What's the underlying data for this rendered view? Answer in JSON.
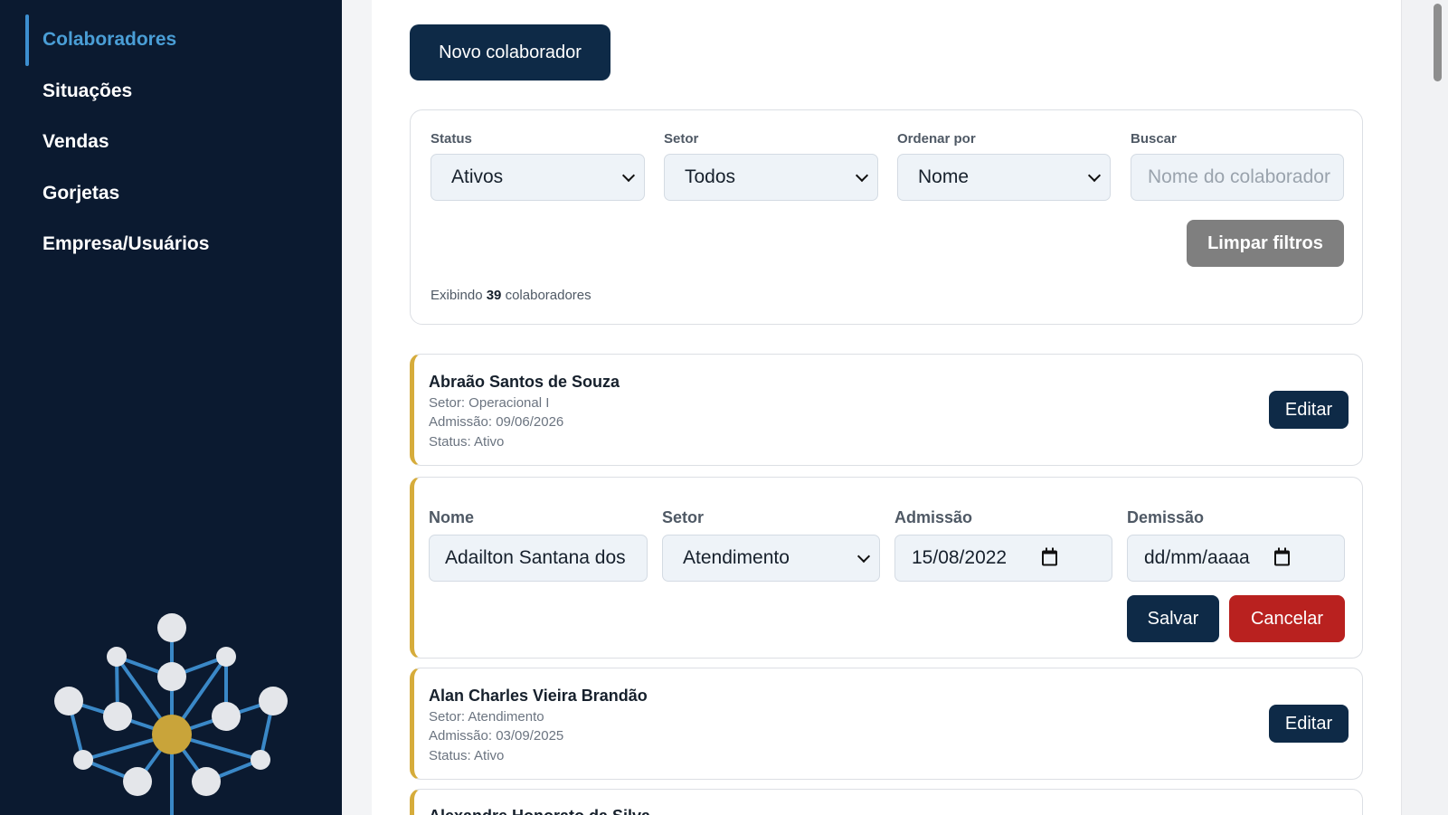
{
  "sidebar": {
    "items": [
      {
        "label": "Colaboradores",
        "active": true
      },
      {
        "label": "Situações",
        "active": false
      },
      {
        "label": "Vendas",
        "active": false
      },
      {
        "label": "Gorjetas",
        "active": false
      },
      {
        "label": "Empresa/Usuários",
        "active": false
      }
    ]
  },
  "toolbar": {
    "new_label": "Novo colaborador"
  },
  "filters": {
    "status": {
      "label": "Status",
      "value": "Ativos"
    },
    "sector": {
      "label": "Setor",
      "value": "Todos"
    },
    "order": {
      "label": "Ordenar por",
      "value": "Nome"
    },
    "search": {
      "label": "Buscar",
      "placeholder": "Nome do colaborador"
    },
    "clear_label": "Limpar filtros",
    "count_prefix": "Exibindo",
    "count_value": "39",
    "count_suffix": "colaboradores"
  },
  "employees": [
    {
      "name": "Abraão Santos de Souza",
      "sector": "Setor: Operacional I",
      "admission": "Admissão: 09/06/2026",
      "status": "Status: Ativo",
      "edit_label": "Editar"
    },
    {
      "name": "Alan Charles Vieira Brandão",
      "sector": "Setor: Atendimento",
      "admission": "Admissão: 03/09/2025",
      "status": "Status: Ativo",
      "edit_label": "Editar"
    },
    {
      "name": "Alexandre Honorato da Silva"
    }
  ],
  "edit_form": {
    "name_label": "Nome",
    "name_value": "Adailton Santana dos",
    "sector_label": "Setor",
    "sector_value": "Atendimento",
    "admission_label": "Admissão",
    "admission_value": "15/08/2022",
    "dismissal_label": "Demissão",
    "dismissal_value": "dd/mm/aaaa",
    "save_label": "Salvar",
    "cancel_label": "Cancelar"
  },
  "colors": {
    "sidebar_bg": "#0b1a30",
    "primary": "#0e2a47",
    "accent_active": "#4a9ed6",
    "card_border_accent": "#d6ac3b",
    "cancel": "#b9211f",
    "clear": "#7f7f7f"
  },
  "icons": [
    "chevron-down-icon",
    "calendar-icon",
    "network-logo"
  ]
}
